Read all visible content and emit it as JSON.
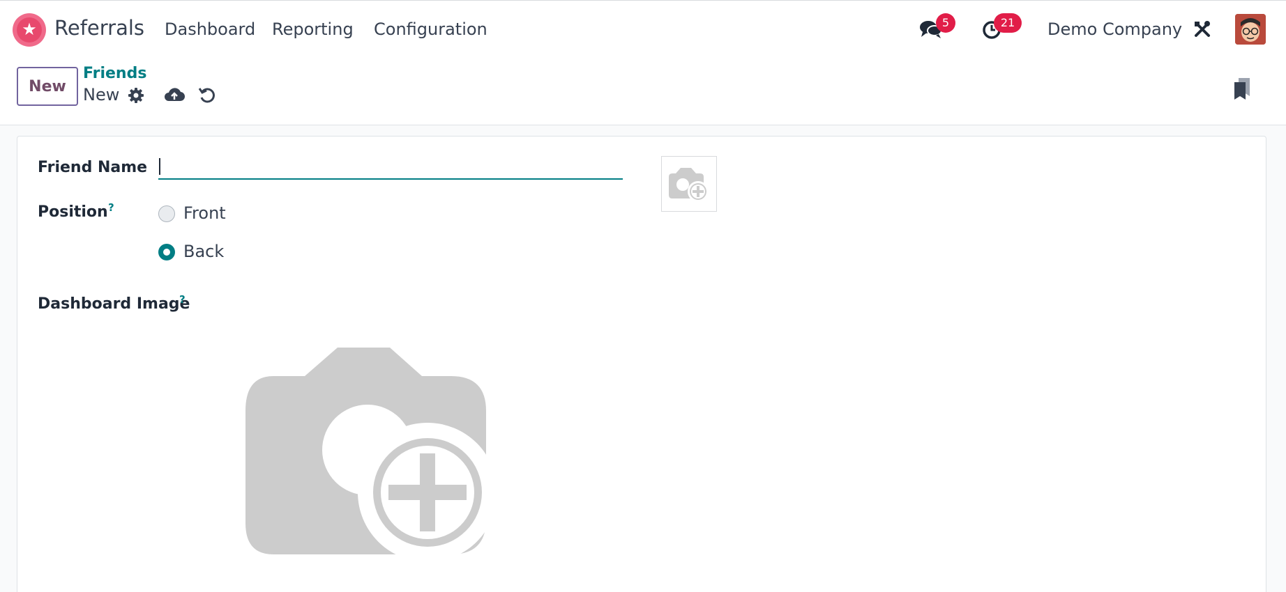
{
  "app": {
    "name": "Referrals",
    "logo_icon": "referrals-star-icon",
    "brand_color": "#e8496d"
  },
  "menu": [
    {
      "label": "Dashboard"
    },
    {
      "label": "Reporting"
    },
    {
      "label": "Configuration"
    }
  ],
  "systray": {
    "messages_count": "5",
    "activities_count": "21",
    "company": "Demo Company",
    "badge_color": "#e11d48"
  },
  "control_panel": {
    "new_button": "New",
    "breadcrumb": "Friends",
    "record_name": "New"
  },
  "form": {
    "friend_name_label": "Friend Name",
    "friend_name_value": "",
    "position_label": "Position",
    "help_mark": "?",
    "position_options": [
      {
        "label": "Front",
        "selected": false
      },
      {
        "label": "Back",
        "selected": true
      }
    ],
    "dashboard_image_label": "Dashboard Image"
  },
  "colors": {
    "accent": "#017e84",
    "primary": "#714b67",
    "placeholder_image": "#cccccc"
  }
}
